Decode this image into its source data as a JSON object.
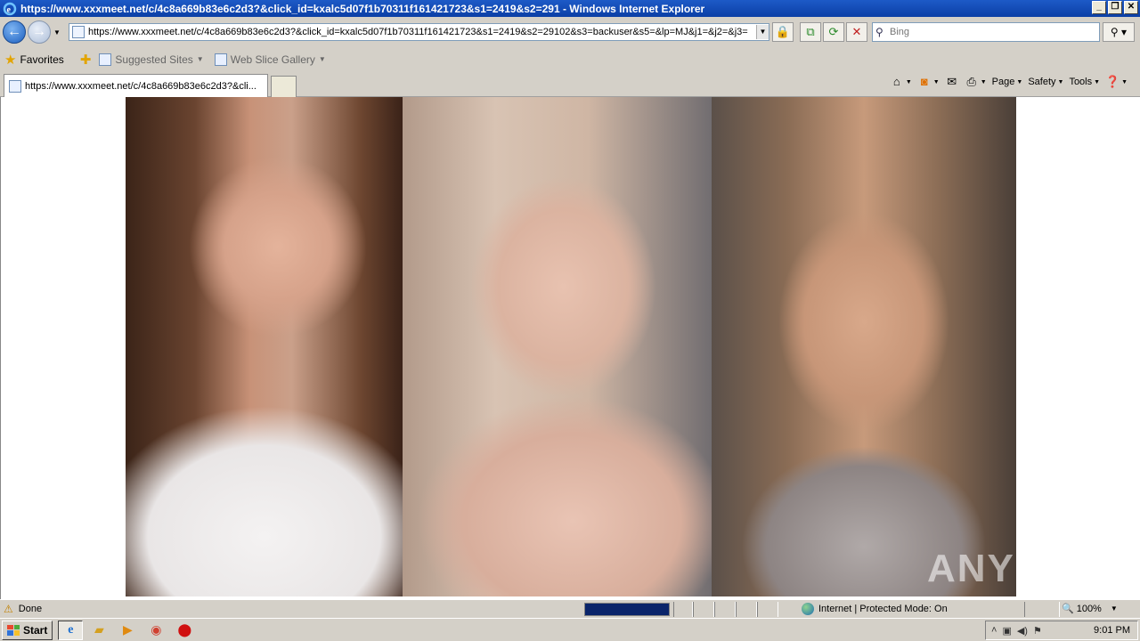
{
  "window": {
    "title": "https://www.xxxmeet.net/c/4c8a669b83e6c2d3?&click_id=kxalc5d07f1b70311f1614217​23&s1=2419&s2=291 - Windows Internet Explorer",
    "minimize": "_",
    "restore": "❐",
    "close": "✕"
  },
  "nav": {
    "back": "←",
    "forward": "→",
    "url": "https://www.xxxmeet.net/c/4c8a669b83e6c2d3?&click_id=kxalc5d07f1b70311f1614217​23&s1=2419&s2=29102&s3=backuser&s5=&lp=MJ&j1=&j2=&j3=",
    "search_placeholder": "Bing"
  },
  "favorites": {
    "favorites_label": "Favorites",
    "suggested_sites": "Suggested Sites",
    "web_slice_gallery": "Web Slice Gallery"
  },
  "tabs": {
    "active_tab": "https://www.xxxmeet.net/c/4c8a669b83e6c2d3?&cli..."
  },
  "commandbar": {
    "page": "Page",
    "safety": "Safety",
    "tools": "Tools"
  },
  "content": {
    "watermark": "ANY RUN"
  },
  "status": {
    "text": "Done",
    "zone": "Internet | Protected Mode: On",
    "zoom": "100%",
    "progress": 1.0
  },
  "taskbar": {
    "start": "Start",
    "clock": "9:01 PM"
  }
}
